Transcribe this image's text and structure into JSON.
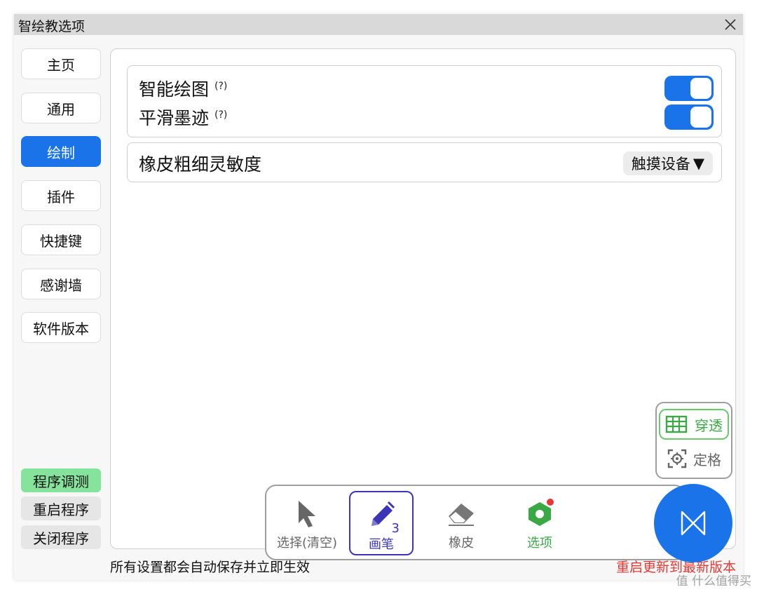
{
  "window": {
    "title": "智绘教选项"
  },
  "sidebar": {
    "items": [
      {
        "label": "主页"
      },
      {
        "label": "通用"
      },
      {
        "label": "绘制"
      },
      {
        "label": "插件"
      },
      {
        "label": "快捷键"
      },
      {
        "label": "感谢墙"
      },
      {
        "label": "软件版本"
      }
    ],
    "active": "绘制",
    "bottom": [
      {
        "label": "程序调测"
      },
      {
        "label": "重启程序"
      },
      {
        "label": "关闭程序"
      }
    ]
  },
  "settings": {
    "smart_draw": {
      "label": "智能绘图",
      "help": "(?)",
      "enabled": true
    },
    "smooth_ink": {
      "label": "平滑墨迹",
      "help": "(?)",
      "enabled": true
    },
    "eraser_sensitivity": {
      "label": "橡皮粗细灵敏度",
      "value": "触摸设备",
      "arrow": "▼"
    }
  },
  "footer": {
    "note": "所有设置都会自动保存并立即生效",
    "update_link": "重启更新到最新版本"
  },
  "toolbar": {
    "tools": [
      {
        "label": "选择(清空)",
        "icon": "cursor-icon"
      },
      {
        "label": "画笔",
        "icon": "pen-icon",
        "badge": "3",
        "active": true
      },
      {
        "label": "橡皮",
        "icon": "eraser-icon"
      },
      {
        "label": "选项",
        "icon": "options-icon"
      }
    ],
    "mini": [
      {
        "label": "穿透",
        "icon": "grid-icon"
      },
      {
        "label": "定格",
        "icon": "freeze-icon"
      }
    ],
    "fab_icon": "bowtie-icon"
  },
  "watermark": "值 什么值得买",
  "colors": {
    "accent": "#1a73e8",
    "green": "#3aa845",
    "red": "#e53935",
    "pen": "#3b36b8"
  }
}
